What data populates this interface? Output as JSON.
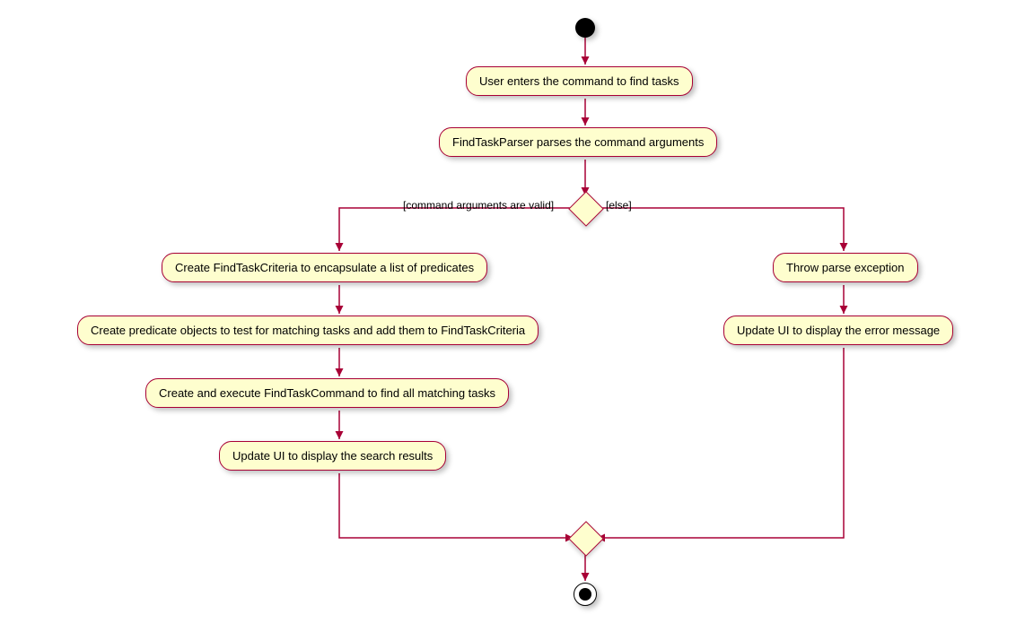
{
  "nodes": {
    "a1": "User enters the command to find tasks",
    "a2": "FindTaskParser parses the command arguments",
    "a3": "Create FindTaskCriteria to encapsulate a list of predicates",
    "a4": "Create predicate objects to test for matching tasks and add them to FindTaskCriteria",
    "a5": "Create and execute FindTaskCommand to find all matching tasks",
    "a6": "Update UI to display the search results",
    "b1": "Throw parse exception",
    "b2": "Update UI to display the error message"
  },
  "guards": {
    "left": "[command arguments are valid]",
    "right": "[else]"
  },
  "chart_data": {
    "type": "activity-diagram",
    "start": "start",
    "end": "end",
    "decision": "d1",
    "merge": "m1",
    "edges": [
      {
        "from": "start",
        "to": "a1"
      },
      {
        "from": "a1",
        "to": "a2"
      },
      {
        "from": "a2",
        "to": "d1"
      },
      {
        "from": "d1",
        "to": "a3",
        "guard": "[command arguments are valid]"
      },
      {
        "from": "a3",
        "to": "a4"
      },
      {
        "from": "a4",
        "to": "a5"
      },
      {
        "from": "a5",
        "to": "a6"
      },
      {
        "from": "a6",
        "to": "m1"
      },
      {
        "from": "d1",
        "to": "b1",
        "guard": "[else]"
      },
      {
        "from": "b1",
        "to": "b2"
      },
      {
        "from": "b2",
        "to": "m1"
      },
      {
        "from": "m1",
        "to": "end"
      }
    ]
  }
}
